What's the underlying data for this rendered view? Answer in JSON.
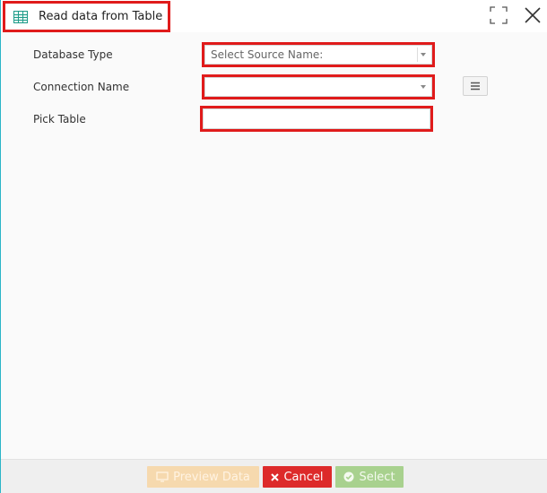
{
  "window": {
    "title": "Read data from Table",
    "icons": {
      "title": "table-icon",
      "maximize": "maximize-icon",
      "close": "close-icon"
    }
  },
  "form": {
    "database_type": {
      "label": "Database Type",
      "placeholder": "Select Source Name:",
      "value": ""
    },
    "connection_name": {
      "label": "Connection Name",
      "value": ""
    },
    "pick_table": {
      "label": "Pick Table",
      "value": "",
      "menu_icon": "hamburger-menu-icon"
    }
  },
  "footer": {
    "preview_label": "Preview Data",
    "cancel_label": "Cancel",
    "select_label": "Select",
    "icons": {
      "preview": "monitor-icon",
      "cancel": "x-icon",
      "select": "check-circle-icon"
    }
  },
  "colors": {
    "highlight": "#e01b1b",
    "cancel": "#dd2a2a",
    "preview_disabled": "#f6d9ae",
    "select_disabled": "#a8d18e",
    "accent_border": "#2bb5c8"
  }
}
